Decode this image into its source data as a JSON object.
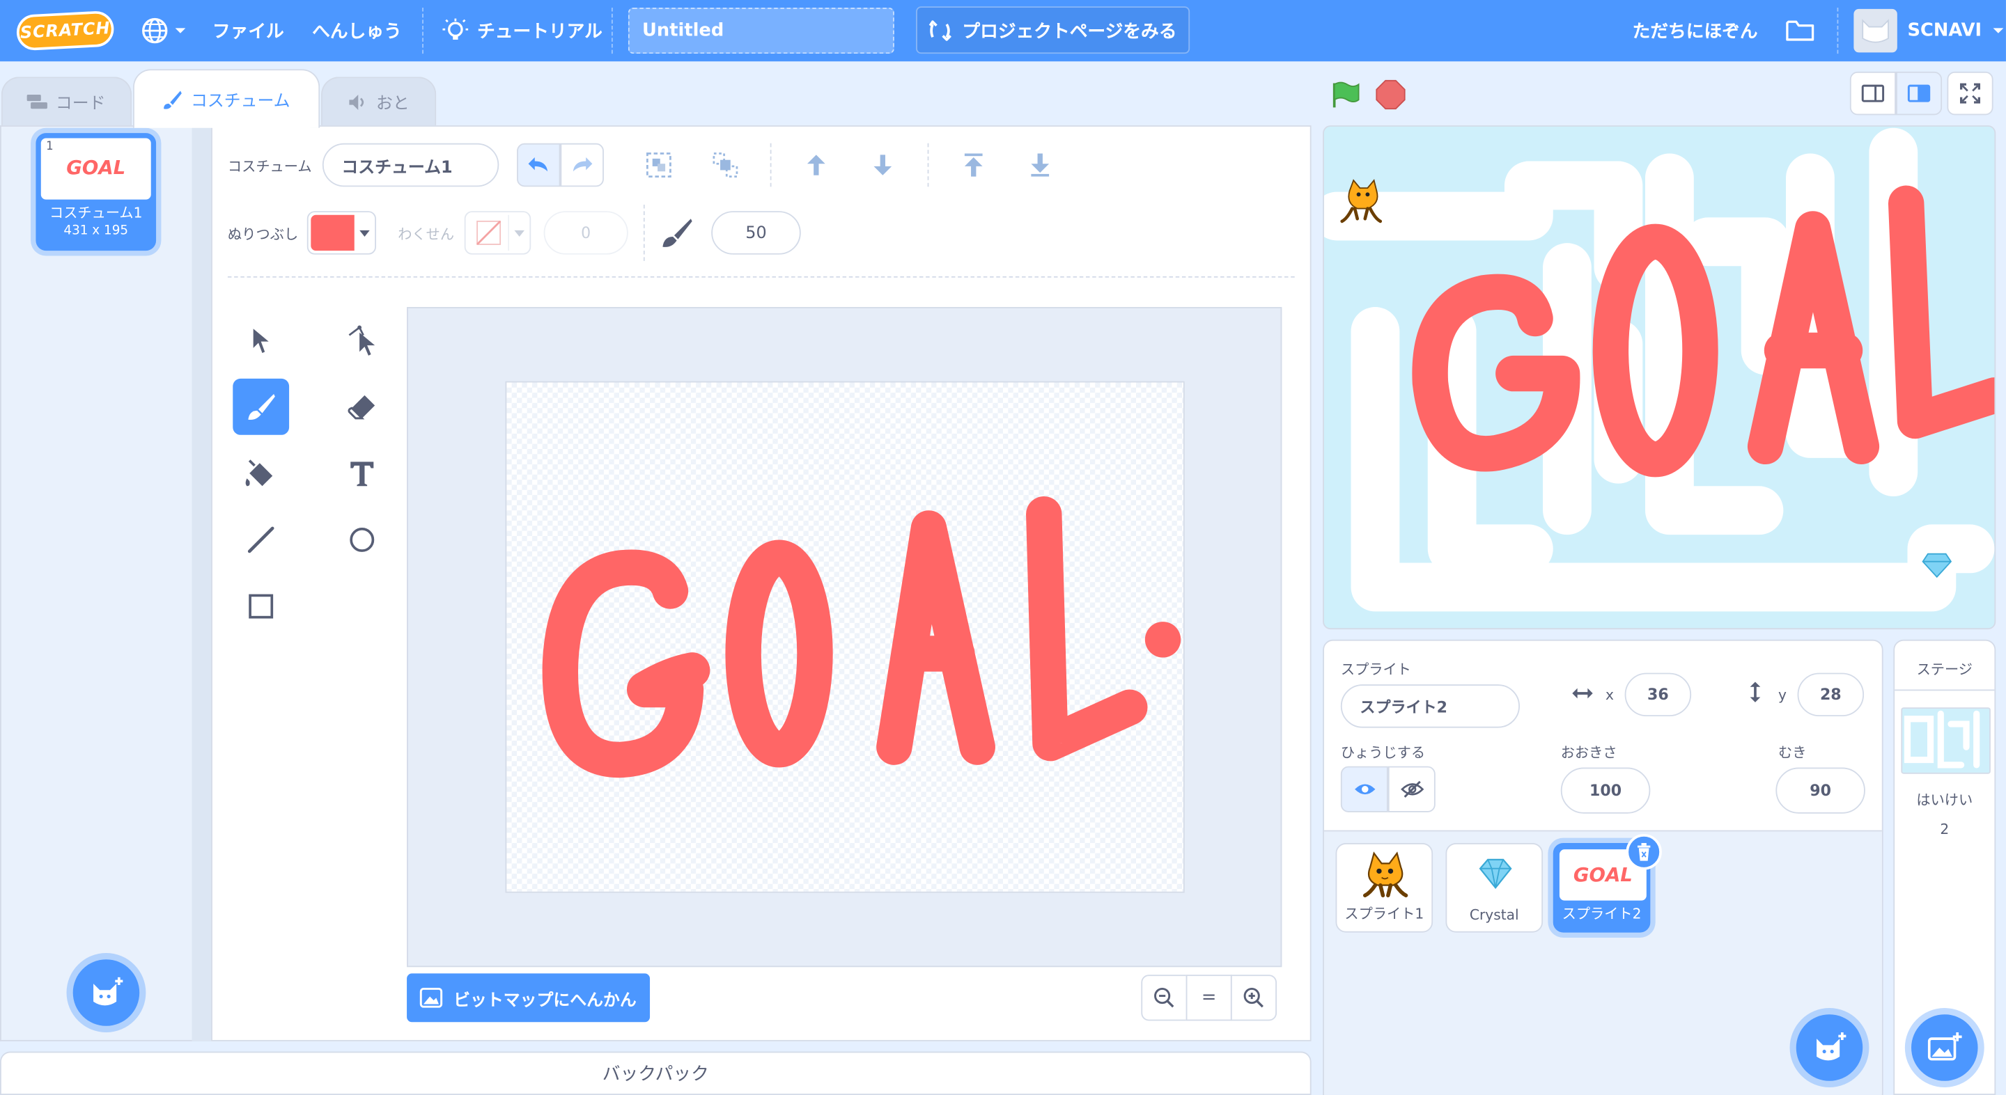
{
  "menubar": {
    "logo": "SCRATCH",
    "file": "ファイル",
    "edit": "へんしゅう",
    "tutorial": "チュートリアル",
    "project_title": "Untitled",
    "see_project": "プロジェクトページをみる",
    "share_now": "ただちにほぞん",
    "username": "SCNAVI",
    "brand_color": "#4c97ff"
  },
  "tabs": {
    "code": "コード",
    "costumes": "コスチューム",
    "sounds": "おと"
  },
  "costume_list": [
    {
      "index": "1",
      "name": "コスチューム1",
      "size": "431 x 195",
      "thumb_text": "GOAL"
    }
  ],
  "paint": {
    "costume_label": "コスチューム",
    "costume_name": "コスチューム1",
    "fill_label": "ぬりつぶし",
    "fill_color": "#ff6666",
    "outline_label": "わくせん",
    "outline_width": "0",
    "brush_size": "50",
    "convert_button": "ビットマップにへんかん",
    "canvas_text": "GOAL",
    "zoom_out": "−",
    "zoom_reset": "=",
    "zoom_in": "+"
  },
  "backpack": "バックパック",
  "stage": {
    "goal_text": "GOAL"
  },
  "sprite_info": {
    "sprite_label": "スプライト",
    "sprite_name": "スプライト2",
    "x_label": "x",
    "x_value": "36",
    "y_label": "y",
    "y_value": "28",
    "show_label": "ひょうじする",
    "size_label": "おおきさ",
    "size_value": "100",
    "direction_label": "むき",
    "direction_value": "90"
  },
  "sprites": [
    {
      "name": "スプライト1",
      "icon": "cat-icon"
    },
    {
      "name": "Crystal",
      "icon": "crystal-icon"
    },
    {
      "name": "スプライト2",
      "icon": "goal-thumb",
      "thumb_text": "GOAL",
      "selected": true
    }
  ],
  "stage_panel": {
    "title": "ステージ",
    "backdrops_label": "はいけい",
    "backdrops_count": "2"
  }
}
